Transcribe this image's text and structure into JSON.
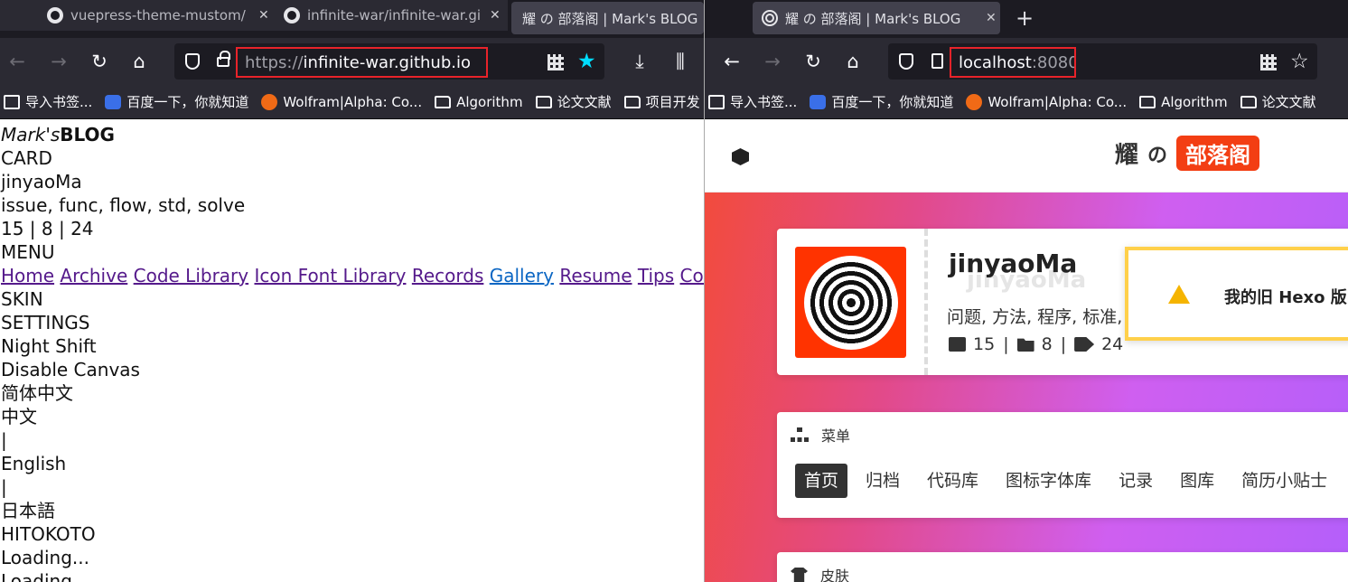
{
  "left_window": {
    "tabs": [
      {
        "title": "vuepress-theme-mustom/",
        "icon": "github-icon"
      },
      {
        "title": "infinite-war/infinite-war.gi",
        "icon": "github-icon"
      },
      {
        "title": "耀 の 部落阁 | Mark's BLOG",
        "icon": "none"
      }
    ],
    "url_scheme": "https://",
    "url_host": "infinite-war.github.io",
    "bookmarks": [
      "导入书签...",
      "百度一下，你就知道",
      "Wolfram|Alpha: Co...",
      "Algorithm",
      "论文文献",
      "项目开发"
    ],
    "page": {
      "brand_italic": "Mark's",
      "brand_bold": "BLOG",
      "lines_top": [
        "CARD",
        "jinyaoMa",
        "issue, func, flow, std, solve",
        "15 | 8 | 24",
        "MENU"
      ],
      "menu_links": [
        "Home",
        "Archive",
        "Code Library",
        "Icon Font Library",
        "Records",
        "Gallery",
        "Resume",
        "Tips",
        "Cover"
      ],
      "lines_bottom": [
        "SKIN",
        "SETTINGS",
        "Night Shift",
        "Disable Canvas",
        "简体中文",
        "中文",
        "|",
        "English",
        "|",
        "日本語",
        "HITOKOTO",
        "Loading...",
        "Loading..."
      ]
    }
  },
  "right_window": {
    "tab_title": "耀 の 部落阁 | Mark's BLOG",
    "url_host": "localhost",
    "url_port": ":8080",
    "bookmarks": [
      "导入书签...",
      "百度一下，你就知道",
      "Wolfram|Alpha: Co...",
      "Algorithm",
      "论文文献"
    ],
    "site": {
      "title_main": "耀",
      "title_sub": "の",
      "title_badge": "部落阁",
      "username": "jinyaoMa",
      "username_shadow": "jinyaoMa",
      "tagline": "问题, 方法, 程序, 标准, 解决",
      "stats": {
        "archives": "15",
        "categories": "8",
        "tags": "24"
      },
      "notice": "我的旧 Hexo 版网站已经",
      "menu_title": "菜单",
      "menu_items": [
        "首页",
        "归档",
        "代码库",
        "图标字体库",
        "记录",
        "图库",
        "简历小贴士"
      ],
      "skin_title": "皮肤"
    }
  },
  "colors": {
    "url_highlight": "#e8232a",
    "badge": "#f33e13",
    "avatar_bg": "#ff3300",
    "notice_border": "#ffd04a",
    "star_active": "#00ddff"
  }
}
